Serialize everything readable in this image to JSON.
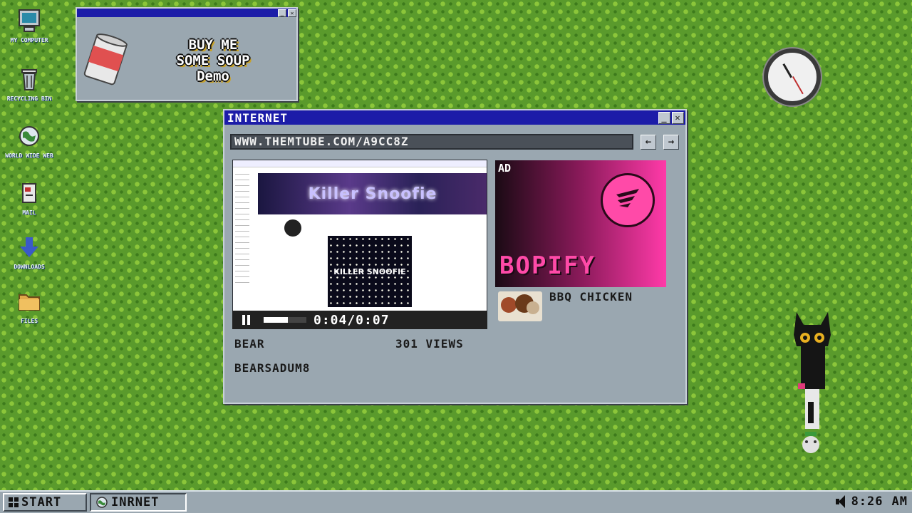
{
  "desktop": {
    "icons": [
      {
        "label": "MY COMPUTER",
        "icon": "computer-icon"
      },
      {
        "label": "RECYCLING BIN",
        "icon": "recycle-bin-icon"
      },
      {
        "label": "WORLD WIDE WEB",
        "icon": "globe-icon"
      },
      {
        "label": "MAIL",
        "icon": "mail-icon"
      },
      {
        "label": "DOWNLOADS",
        "icon": "download-icon"
      },
      {
        "label": "FILES",
        "icon": "folder-icon"
      }
    ]
  },
  "soup_window": {
    "title_line1": "BUY ME",
    "title_line2": "SOME SOUP",
    "title_line3": "Demo"
  },
  "internet_window": {
    "title": "INTERNET",
    "url": "WWW.THEMTUBE.COM/A9CC8Z",
    "back_label": "←",
    "forward_label": "→",
    "video": {
      "channel_banner": "Killer Snoofie",
      "thumbnail_text": "KILLER SNOOFIE",
      "time": "0:04/0:07",
      "progress": 0.57,
      "author": "BEAR",
      "views": "301 VIEWS",
      "username": "BEARSADUM8"
    },
    "ad": {
      "tag": "AD",
      "brand": "BOPIFY"
    },
    "recommended": {
      "title": "BBQ CHICKEN"
    }
  },
  "taskbar": {
    "start_label": "START",
    "task_label": "INRNET",
    "time": "8:26",
    "ampm": "AM"
  },
  "colors": {
    "titlebar": "#1c1ca8",
    "window": "#9aa7b0",
    "desktop": "#5a9a2c",
    "ad_pink": "#ff4aa8"
  }
}
